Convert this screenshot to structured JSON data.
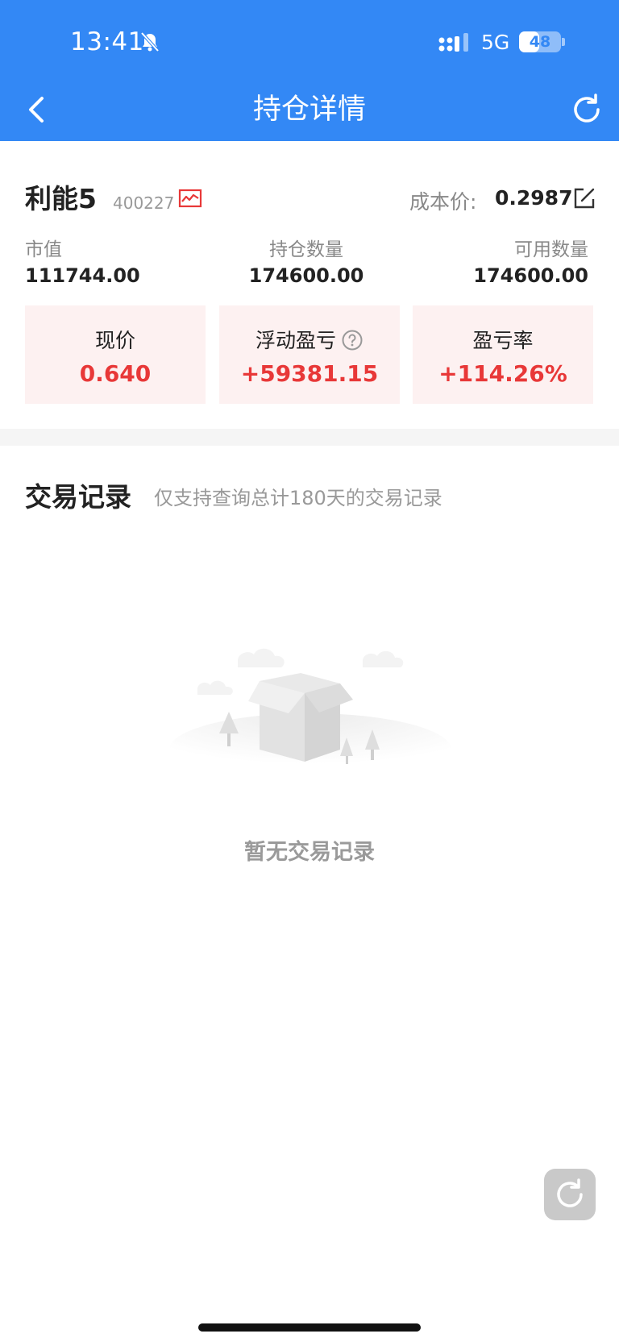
{
  "status_bar": {
    "time": "13:41",
    "network": "5G",
    "battery": "48",
    "battery_level": 0.48,
    "icons": [
      "bell-muted-icon",
      "signal-icon",
      "battery-icon"
    ]
  },
  "nav": {
    "title": "持仓详情",
    "back_icon": "chevron-left-icon",
    "refresh_icon": "refresh-icon"
  },
  "stock": {
    "name": "利能5",
    "code": "400227",
    "chart_icon": "line-chart-icon",
    "cost_label": "成本价:",
    "cost_value": "0.2987",
    "edit_icon": "edit-icon"
  },
  "stats": [
    {
      "label": "市值",
      "value": "111744.00"
    },
    {
      "label": "持仓数量",
      "value": "174600.00"
    },
    {
      "label": "可用数量",
      "value": "174600.00"
    }
  ],
  "cards": [
    {
      "label": "现价",
      "value": "0.640"
    },
    {
      "label": "浮动盈亏",
      "value": "+59381.15",
      "help_icon": "question-circle-icon"
    },
    {
      "label": "盈亏率",
      "value": "+114.26%"
    }
  ],
  "colors": {
    "brand": "#3388f5",
    "gain": "#e83838",
    "card_bg": "#fdf1f1"
  },
  "records": {
    "title": "交易记录",
    "note": "仅支持查询总计180天的交易记录",
    "empty_text": "暂无交易记录",
    "empty_icon": "empty-box-icon"
  },
  "float_button_icon": "refresh-icon"
}
